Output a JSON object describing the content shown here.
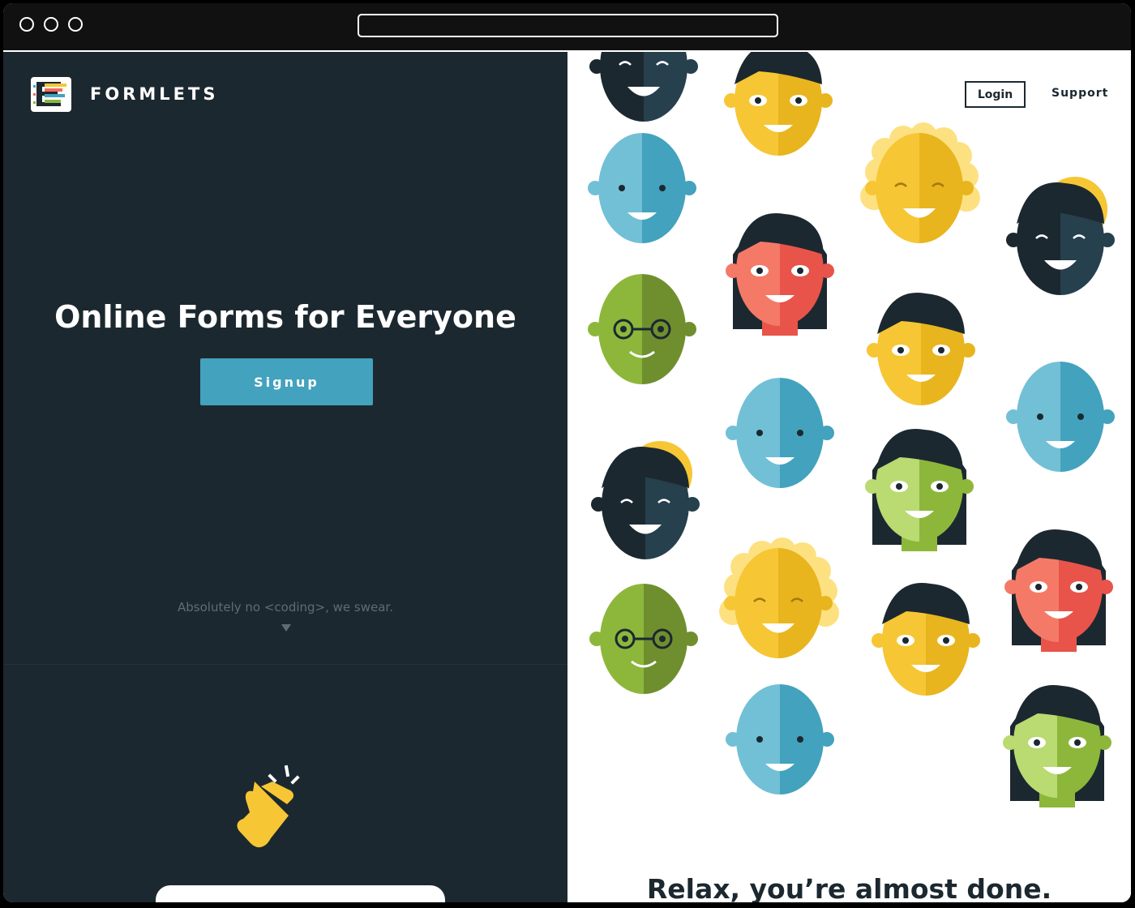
{
  "brand": {
    "name": "FORMLETS"
  },
  "hero": {
    "headline": "Online Forms for Everyone",
    "signup_label": "Signup",
    "tagline": "Absolutely no <coding>, we swear."
  },
  "nav": {
    "login_label": "Login",
    "support_label": "Support"
  },
  "right": {
    "caption": "Relax, you’re almost done."
  },
  "colors": {
    "dark": "#1c2830",
    "accent": "#43a2bd",
    "yellow": "#f6c634",
    "coral": "#f26b5b",
    "green": "#8db73b",
    "blue": "#6cc0d6"
  },
  "icons": [
    "browser-dot-icon",
    "logo-icon",
    "down-arrow-icon",
    "finger-snap-icon"
  ],
  "faces": [
    "person-face-blue",
    "person-face-yellow",
    "person-face-green",
    "person-face-dark",
    "person-face-coral",
    "person-face-lightgreen"
  ]
}
